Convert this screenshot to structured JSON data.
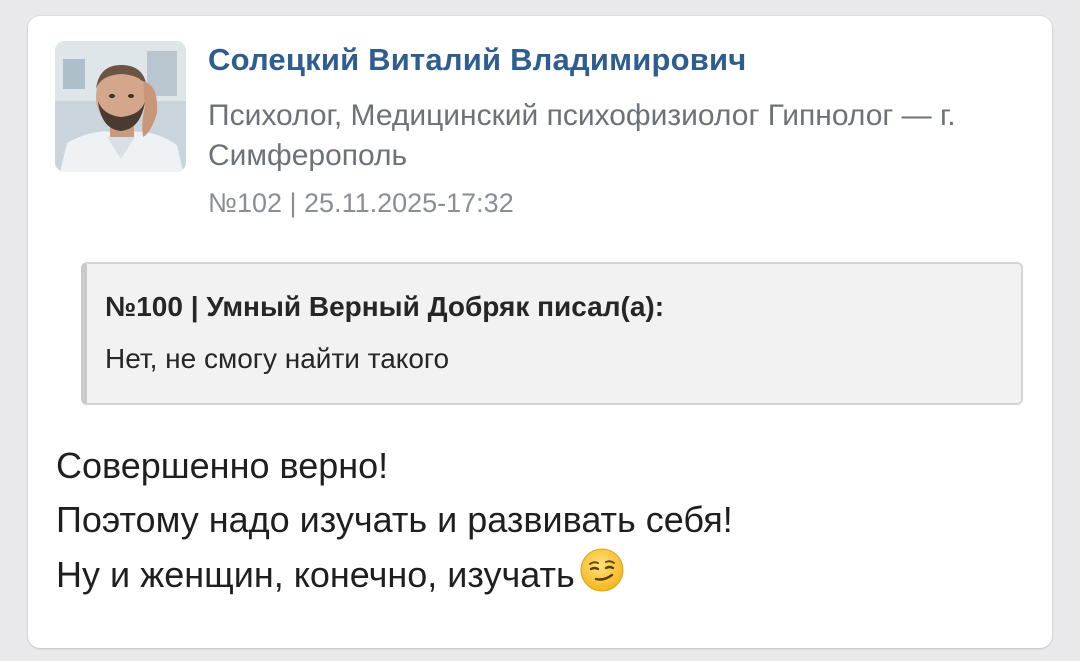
{
  "post": {
    "author_name": "Солецкий Виталий Владимирович",
    "author_role": "Психолог, Медицинский психофизиолог Гипнолог — г. Симферополь",
    "meta": "№102 | 25.11.2025-17:32",
    "quote": {
      "header": "№100 | Умный Верный Добряк писал(а):",
      "text": "Нет, не смогу найти такого"
    },
    "body_lines": [
      "Совершенно верно!",
      "Поэтому надо изучать и развивать себя!",
      "Ну и женщин, конечно, изучать"
    ],
    "emoji": "smirking-face-emoji"
  },
  "colors": {
    "author_name": "#2f5d8f",
    "secondary_text": "#6d7278",
    "quote_background": "#f2f2f3",
    "card_background": "#ffffff",
    "page_background": "#e9e9ec"
  }
}
